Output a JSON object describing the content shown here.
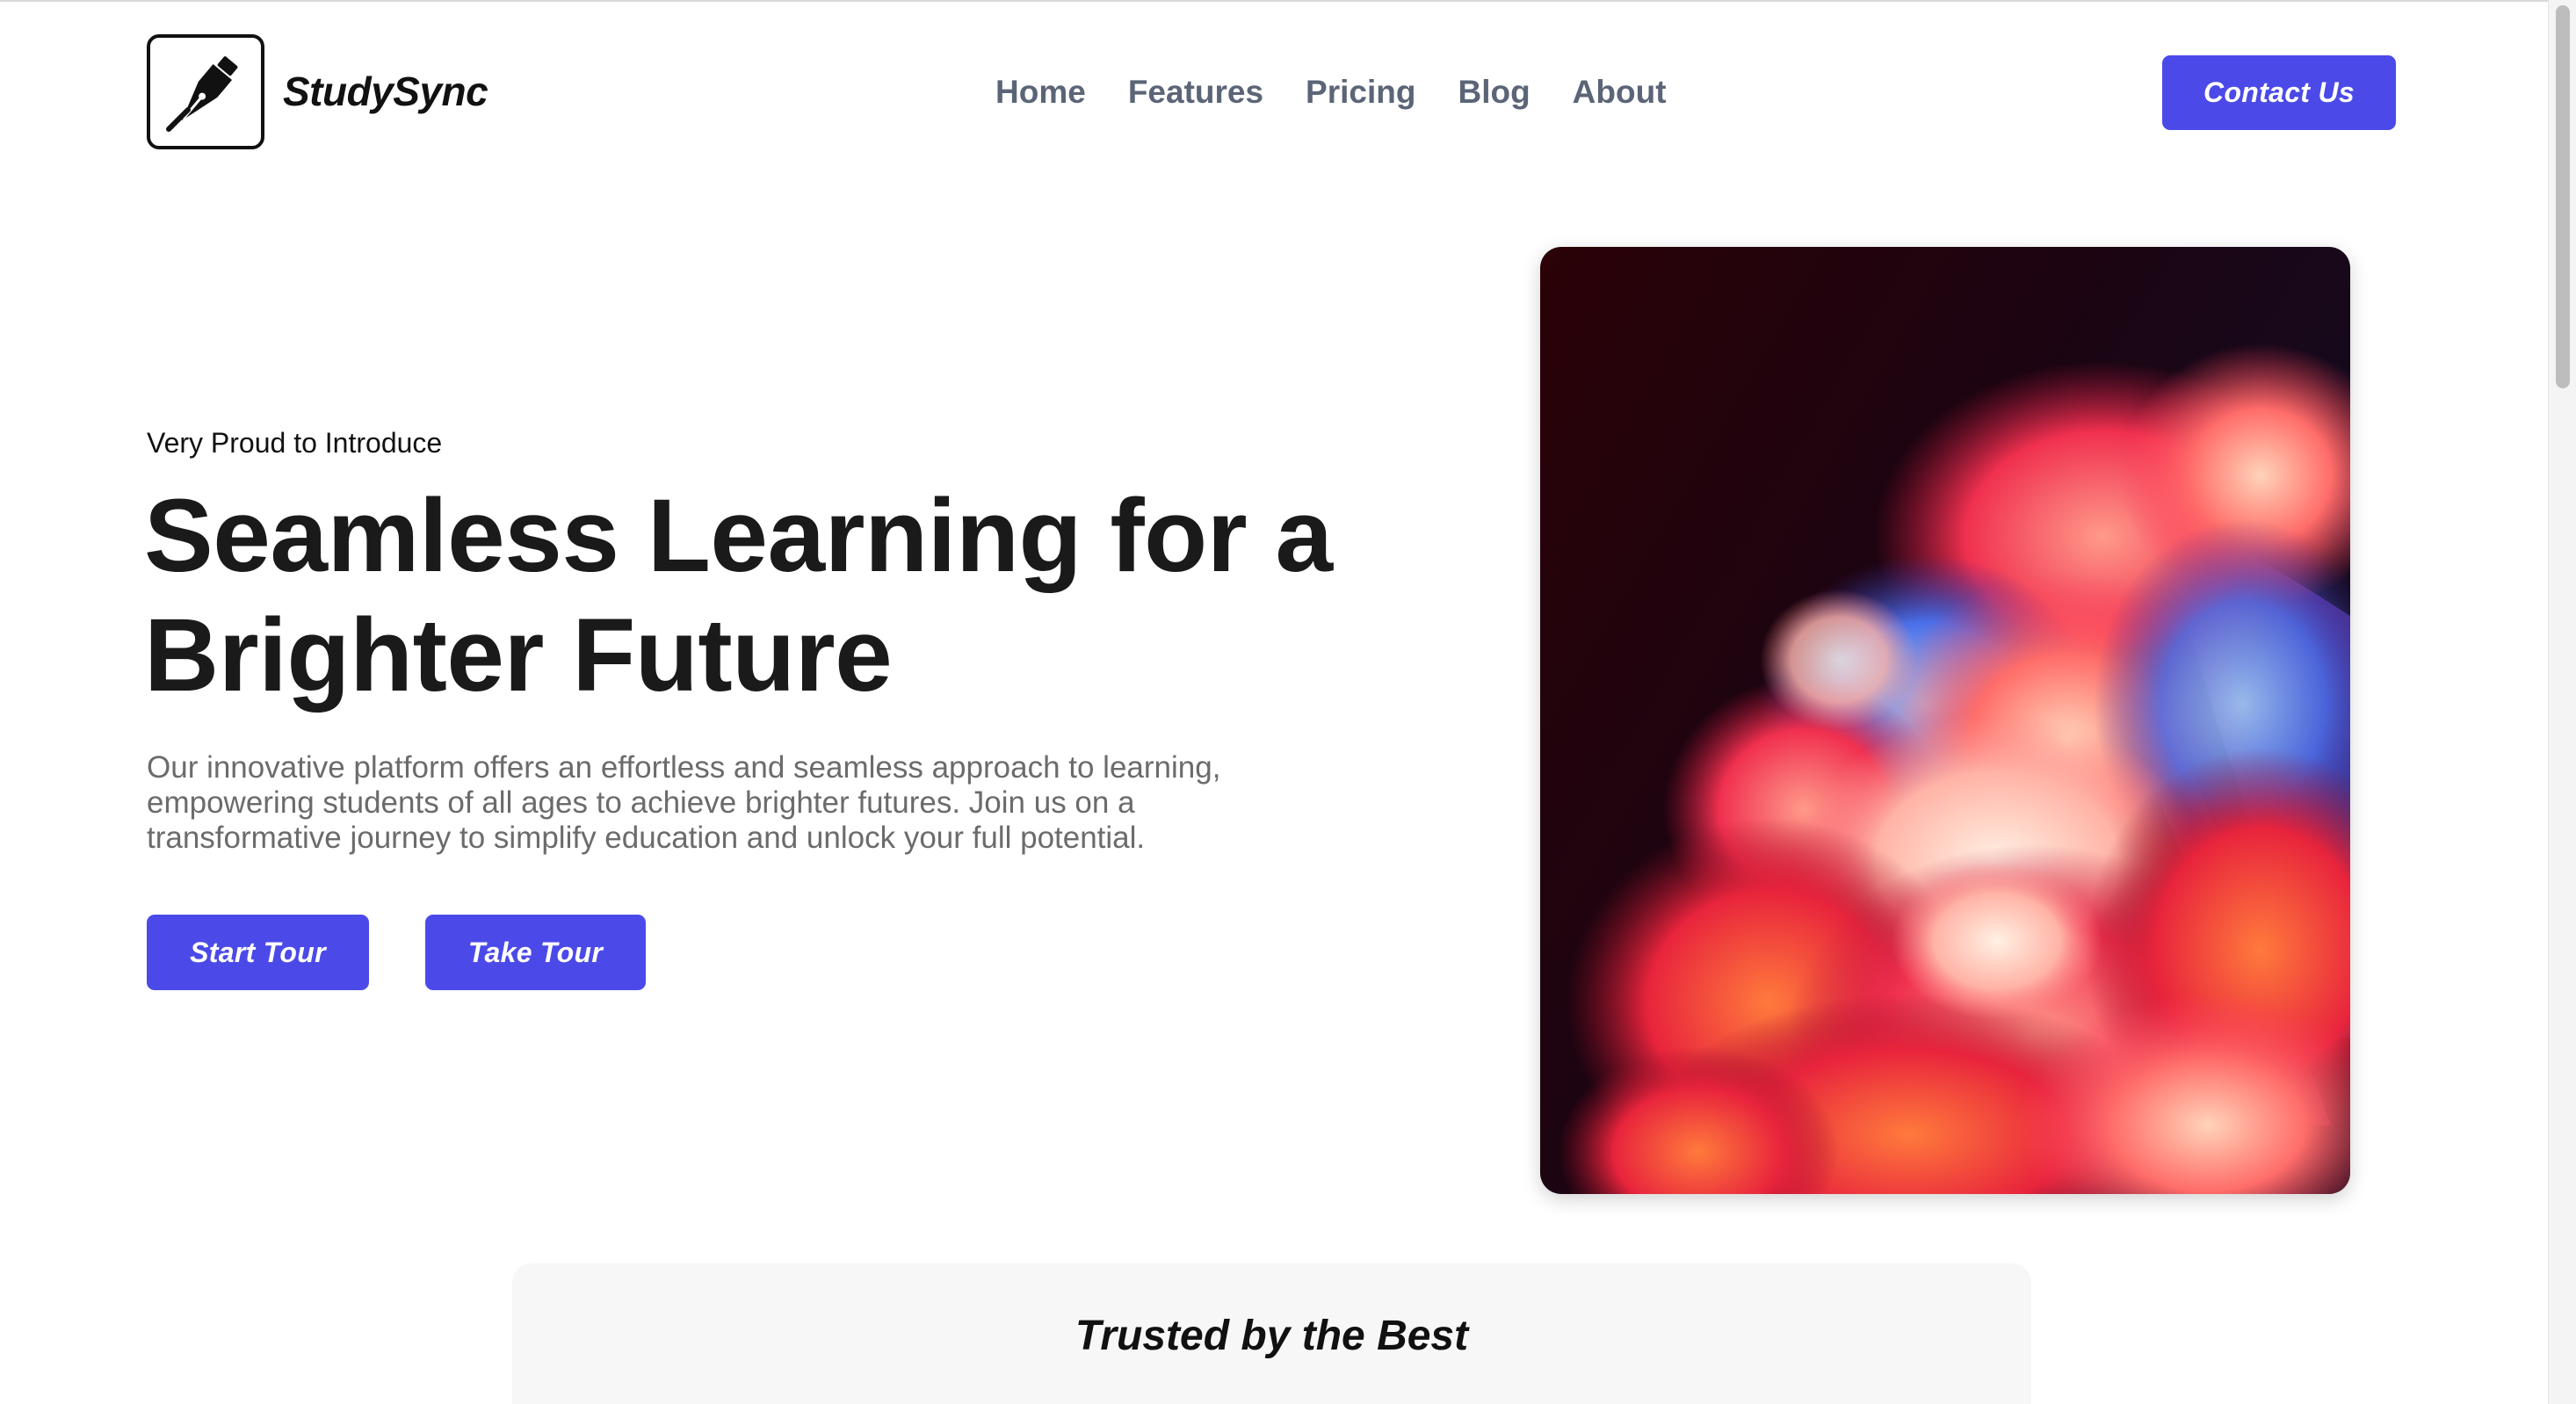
{
  "brand": {
    "name": "StudySync",
    "logo_icon": "fountain-pen-icon"
  },
  "nav": {
    "items": [
      "Home",
      "Features",
      "Pricing",
      "Blog",
      "About"
    ]
  },
  "header": {
    "contact_label": "Contact Us"
  },
  "hero": {
    "kicker": "Very Proud to Introduce",
    "headline_line1": "Seamless Learning for a",
    "headline_line2": "Brighter Future",
    "description": "Our innovative platform offers an effortless and seamless approach to learning, empowering students of all ages to achieve brighter futures. Join us on a transformative journey to simplify education and unlock your full potential.",
    "start_label": "Start Tour",
    "take_label": "Take Tour",
    "image": "colorful-cloud-artwork"
  },
  "trusted": {
    "title": "Trusted by the Best"
  },
  "colors": {
    "accent": "#4b4ae8",
    "nav_text": "#5b6577",
    "body_text": "#6b6b6b",
    "heading": "#1a1a1a"
  }
}
